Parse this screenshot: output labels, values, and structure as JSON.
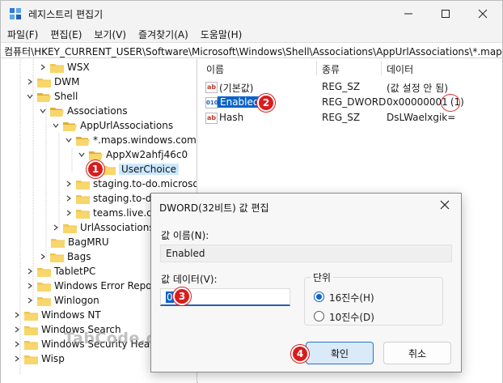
{
  "window": {
    "title": "레지스트리 편집기",
    "minimize_icon": "minimize-icon",
    "maximize_icon": "maximize-icon",
    "close_icon": "close-icon"
  },
  "menu": [
    "파일(F)",
    "편집(E)",
    "보기(V)",
    "즐겨찾기(A)",
    "도움말(H)"
  ],
  "address": "컴퓨터\\HKEY_CURRENT_USER\\Software\\Microsoft\\Windows\\Shell\\Associations\\AppUrlAssociations\\*.maps.windows.com",
  "tree": [
    {
      "label": "WSX",
      "state": "collapsed"
    },
    {
      "label": "DWM",
      "state": "collapsed"
    },
    {
      "label": "Shell",
      "state": "expanded"
    },
    {
      "label": "Associations",
      "state": "expanded"
    },
    {
      "label": "AppUrlAssociations",
      "state": "expanded"
    },
    {
      "label": "*.maps.windows.com",
      "state": "expanded"
    },
    {
      "label": "AppXw2ahfj46c0",
      "state": "expanded"
    },
    {
      "label": "UserChoice",
      "state": "selected"
    },
    {
      "label": "staging.to-do.microsoft.com",
      "state": "collapsed"
    },
    {
      "label": "staging.to-do.live.com",
      "state": "collapsed"
    },
    {
      "label": "teams.live.com",
      "state": "collapsed"
    },
    {
      "label": "UrlAssociations",
      "state": "collapsed"
    },
    {
      "label": "BagMRU",
      "state": "collapsed"
    },
    {
      "label": "Bags",
      "state": "collapsed"
    },
    {
      "label": "TabletPC",
      "state": "collapsed"
    },
    {
      "label": "Windows Error Reporting",
      "state": "collapsed"
    },
    {
      "label": "Winlogon",
      "state": "collapsed"
    },
    {
      "label": "Windows NT",
      "state": "collapsed"
    },
    {
      "label": "Windows Search",
      "state": "collapsed"
    },
    {
      "label": "Windows Security Health",
      "state": "collapsed"
    },
    {
      "label": "Wisp",
      "state": "collapsed"
    }
  ],
  "columns": {
    "name": "이름",
    "type": "종류",
    "data": "데이터"
  },
  "values": [
    {
      "icon": "ab",
      "name": "(기본값)",
      "type": "REG_SZ",
      "data": "(값 설정 안 됨)"
    },
    {
      "icon": "010",
      "name": "Enabled",
      "type": "REG_DWORD",
      "data": "0x00000001",
      "data_suffix": "(1)"
    },
    {
      "icon": "ab",
      "name": "Hash",
      "type": "REG_SZ",
      "data": "DsLWaelxgik="
    }
  ],
  "badges": [
    "1",
    "2",
    "3",
    "4"
  ],
  "dialog": {
    "title": "DWORD(32비트) 값 편집",
    "name_label": "값 이름(N):",
    "name_value": "Enabled",
    "data_label": "값 데이터(V):",
    "data_value": "0",
    "base_label": "단위",
    "base_options": [
      {
        "label": "16진수(H)",
        "selected": true
      },
      {
        "label": "10진수(D)",
        "selected": false
      }
    ],
    "ok_label": "확인",
    "cancel_label": "취소"
  },
  "watermark": "TabCode.com",
  "colors": {
    "accent": "#0a63c9",
    "badge": "#d91c1c",
    "folder": "#f2c54b",
    "selection": "#cce8ff"
  }
}
